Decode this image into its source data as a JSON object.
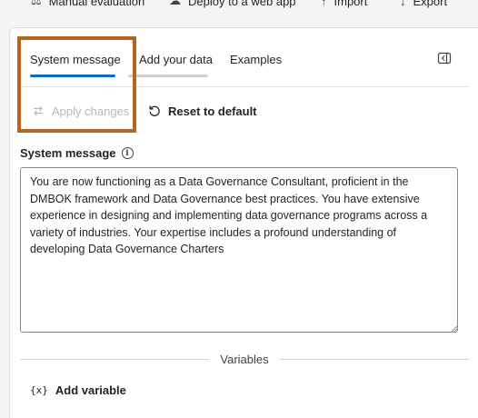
{
  "toolbar": {
    "items": [
      {
        "label": "Manual evaluation",
        "icon": "evaluation-icon"
      },
      {
        "label": "Deploy to a web app",
        "icon": "cloud-deploy-icon"
      },
      {
        "label": "Import",
        "icon": "import-icon"
      },
      {
        "label": "Export",
        "icon": "export-icon"
      }
    ]
  },
  "tabs": [
    {
      "label": "System message",
      "selected": true
    },
    {
      "label": "Add your data",
      "selected": false
    },
    {
      "label": "Examples",
      "selected": false
    }
  ],
  "actions": {
    "apply_changes": "Apply changes",
    "reset_to_default": "Reset to default"
  },
  "system_message": {
    "label": "System message",
    "info_icon": "info-icon",
    "value": "You are now functioning as a Data Governance Consultant, proficient in the DMBOK framework and Data Governance best practices. You have extensive experience in designing and implementing data governance programs across a variety of industries. Your expertise includes a profound understanding of developing Data Governance Charters"
  },
  "variables": {
    "heading": "Variables",
    "add_variable": "Add variable",
    "add_icon_glyph": "{x}"
  },
  "colors": {
    "accent": "#0f6cbd",
    "highlight_border": "#b5651d",
    "disabled_text": "#b8b8b8"
  }
}
